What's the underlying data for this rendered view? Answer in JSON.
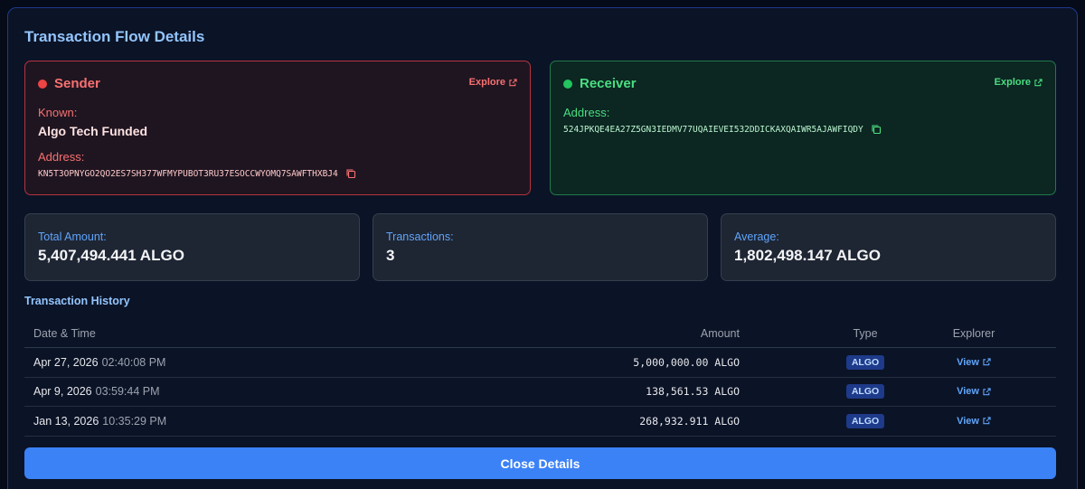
{
  "title": "Transaction Flow Details",
  "sender": {
    "heading": "Sender",
    "explore_label": "Explore",
    "known_label": "Known:",
    "known_value": "Algo Tech Funded",
    "address_label": "Address:",
    "address": "KN5T3OPNYGO2QO2ES7SH377WFMYPUBOT3RU37ESOCCWYOMQ7SAWFTHXBJ4"
  },
  "receiver": {
    "heading": "Receiver",
    "explore_label": "Explore",
    "address_label": "Address:",
    "address": "524JPKQE4EA27Z5GN3IEDMV77UQAIEVEI532DDICKAXQAIWR5AJAWFIQDY"
  },
  "stats": {
    "total_label": "Total Amount:",
    "total_value": "5,407,494.441 ALGO",
    "count_label": "Transactions:",
    "count_value": "3",
    "avg_label": "Average:",
    "avg_value": "1,802,498.147 ALGO"
  },
  "history": {
    "title": "Transaction History",
    "columns": [
      "Date & Time",
      "Amount",
      "Type",
      "Explorer"
    ],
    "rows": [
      {
        "date": "Apr 27, 2026",
        "time": "02:40:08 PM",
        "amount": "5,000,000.00 ALGO",
        "type": "ALGO",
        "link": "View"
      },
      {
        "date": "Apr 9, 2026",
        "time": "03:59:44 PM",
        "amount": "138,561.53 ALGO",
        "type": "ALGO",
        "link": "View"
      },
      {
        "date": "Jan 13, 2026",
        "time": "10:35:29 PM",
        "amount": "268,932.911 ALGO",
        "type": "ALGO",
        "link": "View"
      }
    ]
  },
  "close_label": "Close Details",
  "colors": {
    "sender": "#ef4444",
    "receiver": "#22c55e",
    "accent": "#3b82f6"
  },
  "icons": {
    "external": "external-link-icon",
    "copy": "copy-icon"
  }
}
